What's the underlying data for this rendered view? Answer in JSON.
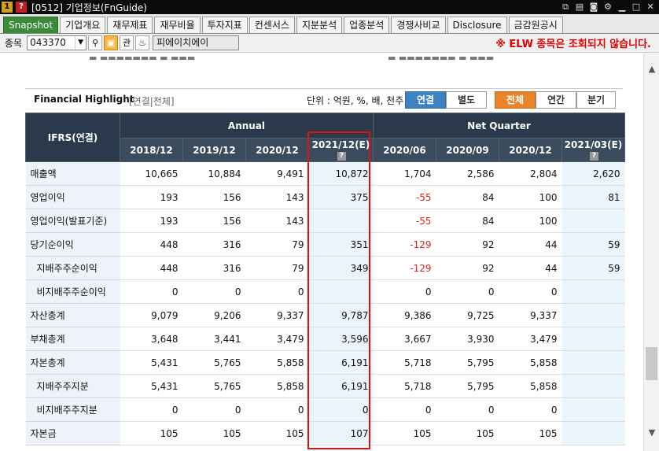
{
  "window": {
    "badge1": "1",
    "badge2": "?",
    "title": "[0512] 기업정보(FnGuide)"
  },
  "tabs": [
    "Snapshot",
    "기업개요",
    "재무제표",
    "재무비율",
    "투자지표",
    "컨센서스",
    "지분분석",
    "업종분석",
    "경쟁사비교",
    "Disclosure",
    "금감원공시"
  ],
  "search": {
    "label": "종목",
    "code": "043370",
    "button_label": "관",
    "name": "피에이치에이",
    "warning": "※ ELW 종목은 조회되지 않습니다."
  },
  "panel": {
    "title": "Financial Highlight",
    "subtitle": "[연결|전체]",
    "unit": "단위 : 억원, %, 배, 천주",
    "consol_toggle": [
      "연결",
      "별도"
    ],
    "period_toggle": [
      "전체",
      "연간",
      "분기"
    ],
    "header": {
      "ifrs": "IFRS(연결)",
      "annual": "Annual",
      "net_quarter": "Net Quarter"
    },
    "annual_cols": [
      "2018/12",
      "2019/12",
      "2020/12",
      "2021/12(E)"
    ],
    "quarter_cols": [
      "2020/06",
      "2020/09",
      "2020/12",
      "2021/03(E)"
    ],
    "rows": [
      {
        "label": "매출액",
        "vals": [
          "10,665",
          "10,884",
          "9,491",
          "10,872",
          "1,704",
          "2,586",
          "2,804",
          "2,620"
        ]
      },
      {
        "label": "영업이익",
        "vals": [
          "193",
          "156",
          "143",
          "375",
          "-55",
          "84",
          "100",
          "81"
        ]
      },
      {
        "label": "영업이익(발표기준)",
        "vals": [
          "193",
          "156",
          "143",
          "",
          "-55",
          "84",
          "100",
          ""
        ]
      },
      {
        "label": "당기순이익",
        "vals": [
          "448",
          "316",
          "79",
          "351",
          "-129",
          "92",
          "44",
          "59"
        ]
      },
      {
        "label": "지배주주순이익",
        "vals": [
          "448",
          "316",
          "79",
          "349",
          "-129",
          "92",
          "44",
          "59"
        ]
      },
      {
        "label": "비지배주주순이익",
        "vals": [
          "0",
          "0",
          "0",
          "",
          "0",
          "0",
          "0",
          ""
        ]
      },
      {
        "label": "자산총계",
        "vals": [
          "9,079",
          "9,206",
          "9,337",
          "9,787",
          "9,386",
          "9,725",
          "9,337",
          ""
        ]
      },
      {
        "label": "부채총계",
        "vals": [
          "3,648",
          "3,441",
          "3,479",
          "3,596",
          "3,667",
          "3,930",
          "3,479",
          ""
        ]
      },
      {
        "label": "자본총계",
        "vals": [
          "5,431",
          "5,765",
          "5,858",
          "6,191",
          "5,718",
          "5,795",
          "5,858",
          ""
        ]
      },
      {
        "label": "지배주주지분",
        "vals": [
          "5,431",
          "5,765",
          "5,858",
          "6,191",
          "5,718",
          "5,795",
          "5,858",
          ""
        ]
      },
      {
        "label": "비지배주주지분",
        "vals": [
          "0",
          "0",
          "0",
          "0",
          "0",
          "0",
          "0",
          ""
        ]
      },
      {
        "label": "자본금",
        "vals": [
          "105",
          "105",
          "105",
          "107",
          "105",
          "105",
          "105",
          ""
        ]
      }
    ]
  },
  "colors": {
    "accent_green": "#3a8a3a",
    "header_navy": "#2a3a4c",
    "negative": "#e02020",
    "highlight": "#e01010",
    "blue_toggle": "#3e82c4",
    "orange_toggle": "#e8842c"
  }
}
